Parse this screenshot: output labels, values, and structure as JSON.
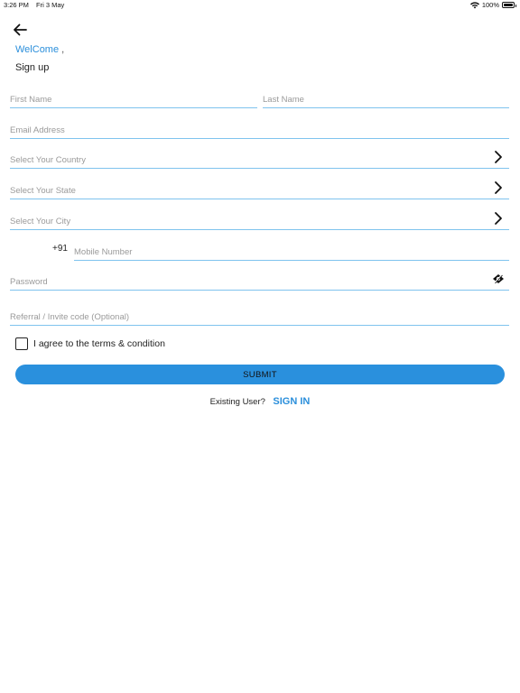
{
  "status_bar": {
    "time": "3:26 PM",
    "date": "Fri 3 May",
    "battery": "100%",
    "battery_level": 1.0,
    "icons": [
      "wifi-icon",
      "battery-icon"
    ]
  },
  "header": {
    "back_icon": "arrow-left-icon",
    "welcome": "WelCome",
    "welcome_comma": ",",
    "title": "Sign up"
  },
  "form": {
    "first_name": {
      "placeholder": "First Name",
      "value": ""
    },
    "last_name": {
      "placeholder": "Last Name",
      "value": ""
    },
    "email": {
      "placeholder": "Email Address",
      "value": ""
    },
    "country": {
      "placeholder": "Select Your Country",
      "value": ""
    },
    "state": {
      "placeholder": "Select Your State",
      "value": ""
    },
    "city": {
      "placeholder": "Select Your City",
      "value": ""
    },
    "phone_prefix": "+91",
    "mobile": {
      "placeholder": "Mobile Number",
      "value": ""
    },
    "password": {
      "placeholder": "Password",
      "value": ""
    },
    "referral": {
      "placeholder": "Referral / Invite code (Optional)",
      "value": ""
    },
    "terms_checked": false,
    "terms_label": "I agree to the terms & condition",
    "submit_label": "SUBMIT"
  },
  "footer": {
    "existing_user": "Existing User?",
    "sign_in": "SIGN IN"
  },
  "colors": {
    "accent": "#2a90dd",
    "link": "#2b8fdb",
    "underline": "#7fc3ee",
    "placeholder": "#9a9a9a"
  }
}
